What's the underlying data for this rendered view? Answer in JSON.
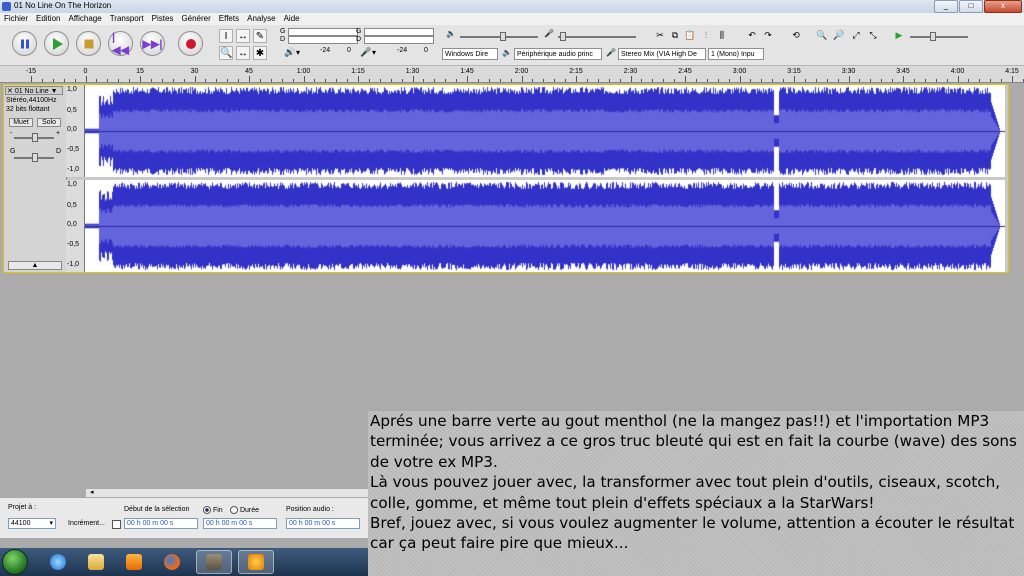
{
  "window": {
    "title": "01 No Line On The Horizon",
    "controls": [
      "_",
      "□",
      "x"
    ]
  },
  "menu": [
    "Fichier",
    "Edition",
    "Affichage",
    "Transport",
    "Pistes",
    "Générer",
    "Effets",
    "Analyse",
    "Aide"
  ],
  "transport": {
    "buttons": [
      "pause",
      "play",
      "stop",
      "skip-start",
      "skip-end",
      "record"
    ]
  },
  "tools": [
    "I",
    "↔",
    "✎",
    "🔍",
    "↔",
    "✱"
  ],
  "meters": {
    "playback_ticks": [
      "-24",
      "0"
    ],
    "record_ticks": [
      "-24",
      "0"
    ],
    "channel_letters": [
      "G",
      "D",
      "G",
      "D"
    ]
  },
  "devices": {
    "host": "Windows Dire",
    "output": "Périphérique audio princ",
    "input": "Stereo Mix (VIA High De",
    "channels": "1 (Mono) Inpu"
  },
  "ruler": {
    "ticks": [
      "-15",
      "0",
      "15",
      "30",
      "45",
      "1:00",
      "1:15",
      "1:30",
      "1:45",
      "2:00",
      "2:15",
      "2:30",
      "2:45",
      "3:00",
      "3:15",
      "3:30",
      "3:45",
      "4:00",
      "4:15"
    ]
  },
  "track": {
    "name": "01 No Line",
    "format": "Stéréo,44100Hz",
    "bits": "32 bits flottant",
    "mute": "Muet",
    "solo": "Solo",
    "gain_minus": "-",
    "gain_plus": "+",
    "pan_left": "G",
    "pan_right": "D",
    "collapse": "▲",
    "scale_labels": [
      "1,0",
      "0,5",
      "0,0",
      "-0,5",
      "-1,0"
    ],
    "colors": {
      "wave": "#3232c8",
      "rms": "#6464dc",
      "border": "#e0c400"
    }
  },
  "selection_bar": {
    "project_label": "Projet à :",
    "rate": "44100",
    "increment_label": "Incrément...",
    "selection_start_label": "Début de la sélection",
    "end_label": "Fin",
    "duration_label": "Durée",
    "audio_position_label": "Position audio :",
    "time_value": "00 h 00 m 00 s"
  },
  "caption": {
    "text": "Aprés une barre verte au gout menthol (ne la mangez pas!!) et l'importation MP3 terminée; vous arrivez a ce gros truc bleuté qui est en fait la courbe (wave) des sons de votre ex MP3.\nLà vous pouvez jouer avec, la transformer avec tout plein d'outils, ciseaux, scotch, colle, gomme, et même tout plein d'effets spéciaux a la StarWars!\nBref, jouez avec, si vous voulez augmenter le volume, attention a écouter le résultat car ça peut faire pire que mieux..."
  },
  "taskbar": {
    "items": [
      "internet-explorer",
      "explorer",
      "media-player",
      "firefox",
      "gimp",
      "audacity"
    ]
  }
}
